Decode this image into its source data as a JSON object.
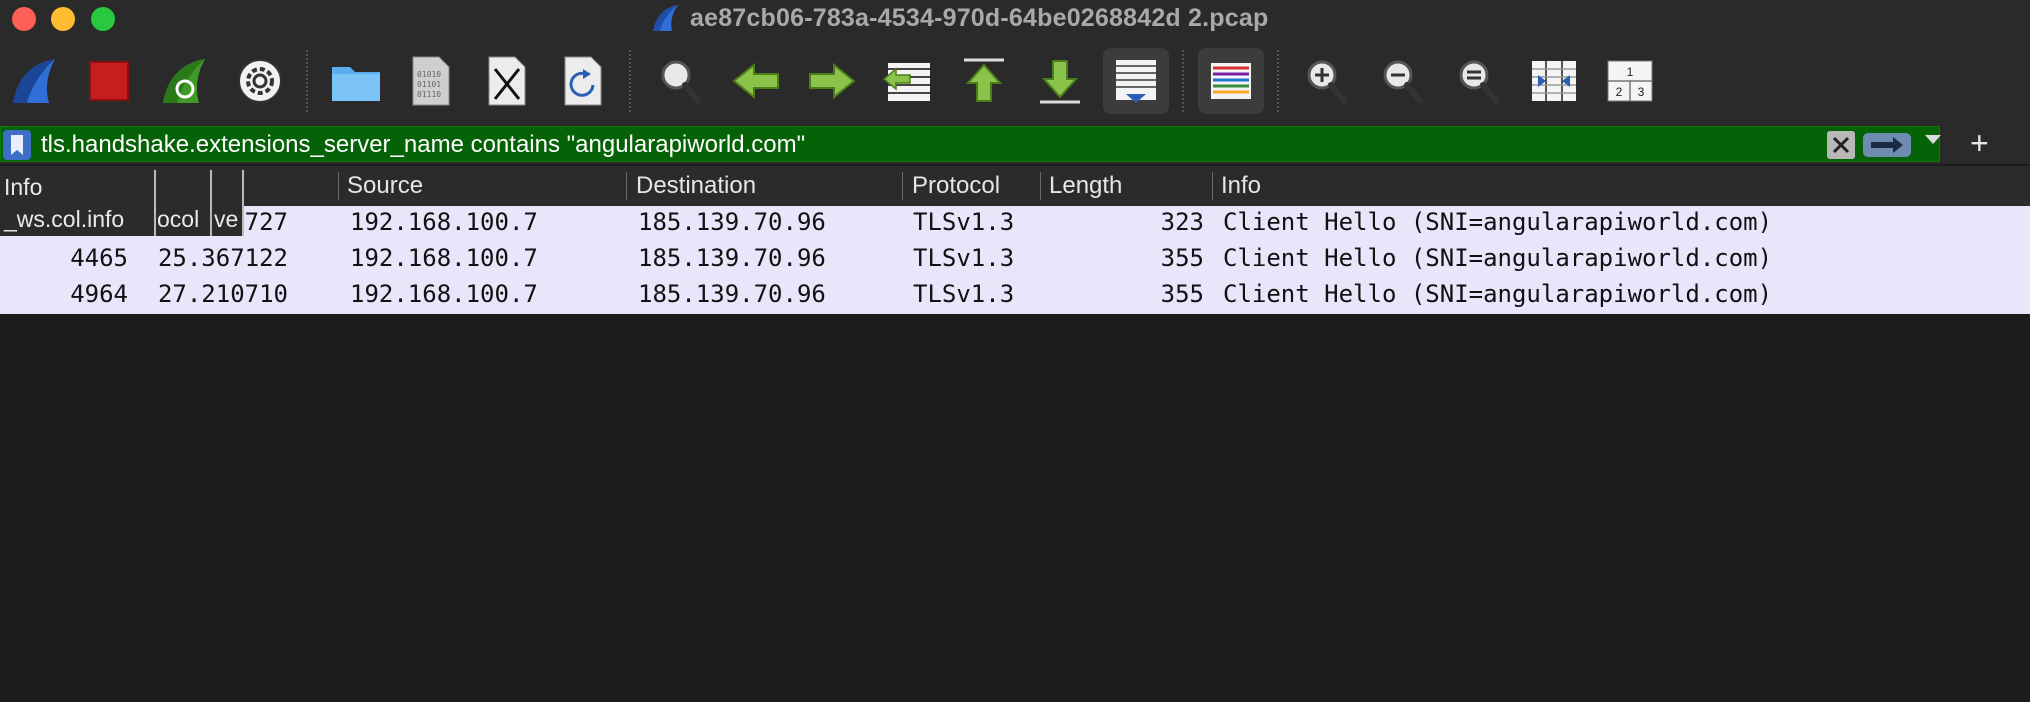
{
  "window": {
    "title": "ae87cb06-783a-4534-970d-64be0268842d 2.pcap"
  },
  "toolbar": {
    "buttons": [
      {
        "name": "start-capture",
        "icon": "shark-fin-icon"
      },
      {
        "name": "stop-capture",
        "icon": "stop-square-icon"
      },
      {
        "name": "restart-capture",
        "icon": "restart-fin-icon"
      },
      {
        "name": "capture-options",
        "icon": "gear-icon"
      },
      {
        "name": "open-file",
        "icon": "folder-icon"
      },
      {
        "name": "save-file",
        "icon": "binary-file-icon"
      },
      {
        "name": "close-file",
        "icon": "close-file-icon"
      },
      {
        "name": "reload-file",
        "icon": "reload-file-icon"
      },
      {
        "name": "find-packet",
        "icon": "magnifier-icon"
      },
      {
        "name": "go-back",
        "icon": "arrow-left-icon"
      },
      {
        "name": "go-forward",
        "icon": "arrow-right-icon"
      },
      {
        "name": "go-to-packet",
        "icon": "goto-packet-icon"
      },
      {
        "name": "first-packet",
        "icon": "arrow-up-to-top-icon"
      },
      {
        "name": "last-packet",
        "icon": "arrow-down-to-bottom-icon"
      },
      {
        "name": "auto-scroll",
        "icon": "autoscroll-icon"
      },
      {
        "name": "colorize",
        "icon": "colorize-lines-icon"
      },
      {
        "name": "zoom-in",
        "icon": "zoom-in-icon"
      },
      {
        "name": "zoom-out",
        "icon": "zoom-out-icon"
      },
      {
        "name": "normal-size",
        "icon": "zoom-normal-icon"
      },
      {
        "name": "resize-columns",
        "icon": "resize-columns-icon"
      },
      {
        "name": "layout",
        "icon": "layout-panes-icon"
      }
    ],
    "layout_icon_digits": [
      "1",
      "2",
      "3"
    ]
  },
  "filter": {
    "value": "tls.handshake.extensions_server_name contains \"angularapiworld.com\"",
    "color": "#066206",
    "plus_label": "+"
  },
  "columns": {
    "source": "Source",
    "destination": "Destination",
    "protocol": "Protocol",
    "length": "Length",
    "info": "Info"
  },
  "ghost_header": {
    "info": "Info",
    "field": "_ws.col.info",
    "protocol_fragment": "ocol",
    "ve_fragment": "ve"
  },
  "packets": [
    {
      "no": "",
      "time": "727",
      "source": "192.168.100.7",
      "destination": "185.139.70.96",
      "protocol": "TLSv1.3",
      "length": "323",
      "info": "Client Hello (SNI=angularapiworld.com)"
    },
    {
      "no": "4465",
      "time": "25.367122",
      "source": "192.168.100.7",
      "destination": "185.139.70.96",
      "protocol": "TLSv1.3",
      "length": "355",
      "info": "Client Hello (SNI=angularapiworld.com)"
    },
    {
      "no": "4964",
      "time": "27.210710",
      "source": "192.168.100.7",
      "destination": "185.139.70.96",
      "protocol": "TLSv1.3",
      "length": "355",
      "info": "Client Hello (SNI=angularapiworld.com)"
    }
  ]
}
